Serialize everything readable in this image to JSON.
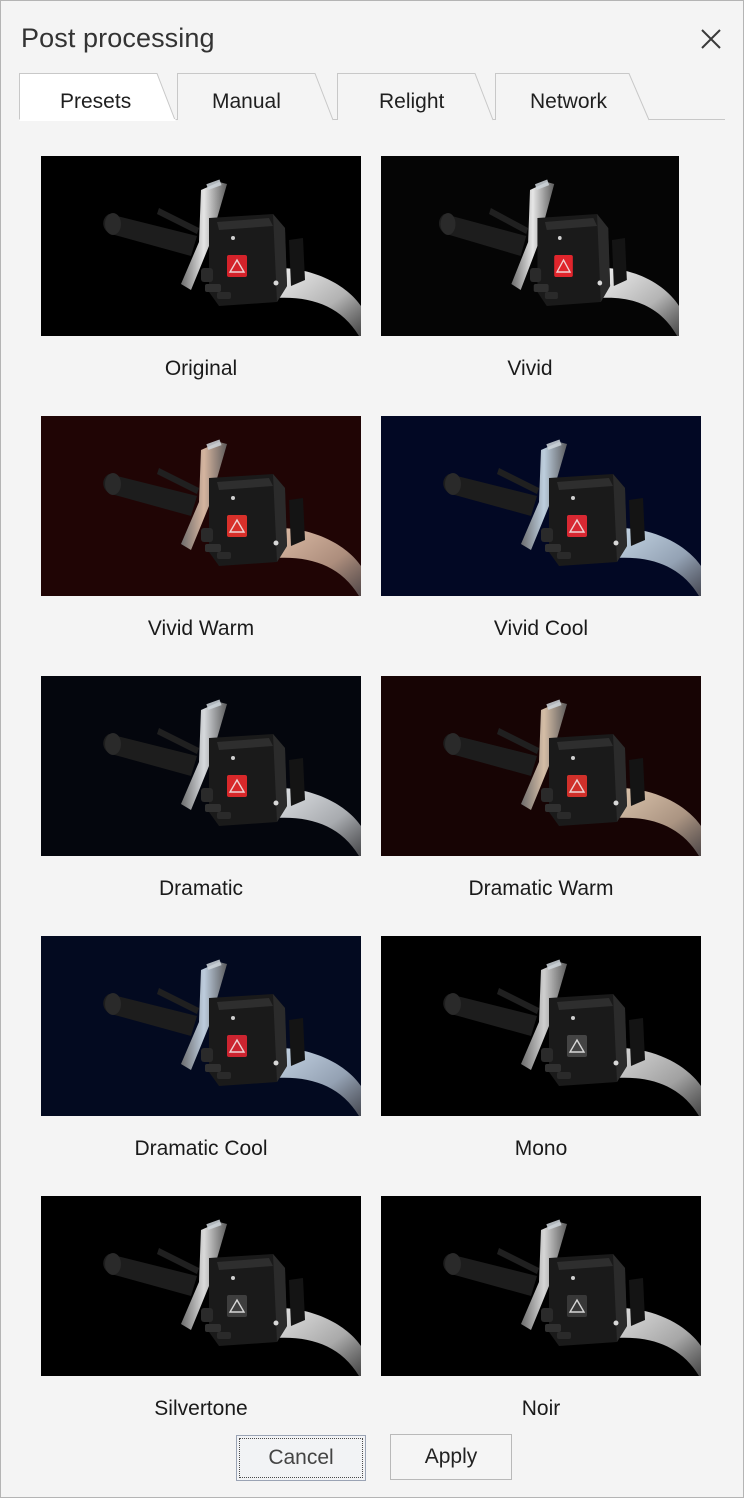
{
  "dialog": {
    "title": "Post processing",
    "close_icon": "close-icon"
  },
  "tabs": [
    {
      "label": "Presets",
      "active": true
    },
    {
      "label": "Manual",
      "active": false
    },
    {
      "label": "Relight",
      "active": false
    },
    {
      "label": "Network",
      "active": false
    }
  ],
  "presets": [
    {
      "label": "Original",
      "bg": "#000000",
      "tint": "#ffffff",
      "button": "#d4222a",
      "selected": false
    },
    {
      "label": "Vivid",
      "bg": "#050505",
      "tint": "#ffffff",
      "button": "#e0252c",
      "selected": false
    },
    {
      "label": "Vivid Warm",
      "bg": "#200505",
      "tint": "#e9c8b0",
      "button": "#d8302a",
      "selected": false
    },
    {
      "label": "Vivid Cool",
      "bg": "#020824",
      "tint": "#d2e4f2",
      "button": "#d82832",
      "selected": false
    },
    {
      "label": "Dramatic",
      "bg": "#04060d",
      "tint": "#eef1f4",
      "button": "#d8282a",
      "selected": false
    },
    {
      "label": "Dramatic Warm",
      "bg": "#170404",
      "tint": "#ead2b8",
      "button": "#d0302a",
      "selected": false
    },
    {
      "label": "Dramatic Cool",
      "bg": "#030a20",
      "tint": "#d2e2f2",
      "button": "#cc2430",
      "selected": false
    },
    {
      "label": "Mono",
      "bg": "#000000",
      "tint": "#e6e6e6",
      "button": "#444444",
      "selected": false
    },
    {
      "label": "Silvertone",
      "bg": "#000000",
      "tint": "#f2f2f2",
      "button": "#3e3e3e",
      "selected": false
    },
    {
      "label": "Noir",
      "bg": "#000000",
      "tint": "#eeeeee",
      "button": "#383838",
      "selected": false
    }
  ],
  "footer": {
    "cancel_label": "Cancel",
    "apply_label": "Apply"
  },
  "colors": {
    "accent": "#1ea0dc",
    "dialog_bg": "#f4f4f4",
    "border": "#b4b4b4"
  }
}
